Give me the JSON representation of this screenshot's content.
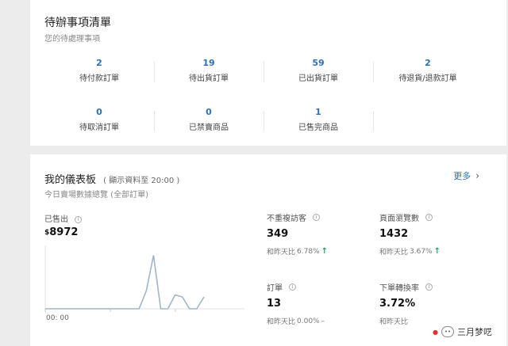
{
  "todo": {
    "title": "待辦事項清單",
    "subtitle": "您的待處理事項",
    "rows": [
      [
        {
          "count": "2",
          "label": "待付款訂單"
        },
        {
          "count": "19",
          "label": "待出貨訂單"
        },
        {
          "count": "59",
          "label": "已出貨訂單"
        },
        {
          "count": "2",
          "label": "待退貨/退款訂單"
        }
      ],
      [
        {
          "count": "0",
          "label": "待取消訂單"
        },
        {
          "count": "0",
          "label": "已禁賣商品"
        },
        {
          "count": "1",
          "label": "已售完商品"
        }
      ]
    ]
  },
  "dashboard": {
    "title": "我的儀表板",
    "note": "( 顯示資料至 20:00 )",
    "subtitle": "今日賣場數據總覽 (全部訂單)",
    "more_label": "更多",
    "sold": {
      "label": "已售出",
      "currency": "$",
      "value": "8972"
    },
    "chart_time_label": "00: 00",
    "metrics": {
      "visitors": {
        "label": "不重複訪客",
        "value": "349",
        "cmp_prefix": "和昨天比",
        "cmp_value": "6.78%",
        "trend": "↑"
      },
      "pageviews": {
        "label": "頁面瀏覽數",
        "value": "1432",
        "cmp_prefix": "和昨天比",
        "cmp_value": "3.67%",
        "trend": "↑"
      },
      "orders": {
        "label": "訂單",
        "value": "13",
        "cmp_prefix": "和昨天比",
        "cmp_value": "0.00%",
        "trend": "–"
      },
      "conversion": {
        "label": "下單轉換率",
        "value": "3.72%",
        "cmp_prefix": "和昨天比",
        "cmp_value": "",
        "trend": ""
      }
    }
  },
  "chart_data": {
    "type": "line",
    "x_start_label": "00: 00",
    "values": [
      0,
      0,
      0,
      0,
      0,
      0,
      0,
      0,
      0,
      0,
      0,
      0,
      0,
      0,
      0.09,
      0.27,
      0,
      0,
      0.07,
      0.06,
      0,
      0,
      0.06
    ],
    "color": "#9fb5cc"
  },
  "watermark": {
    "text": "三月梦呓"
  }
}
